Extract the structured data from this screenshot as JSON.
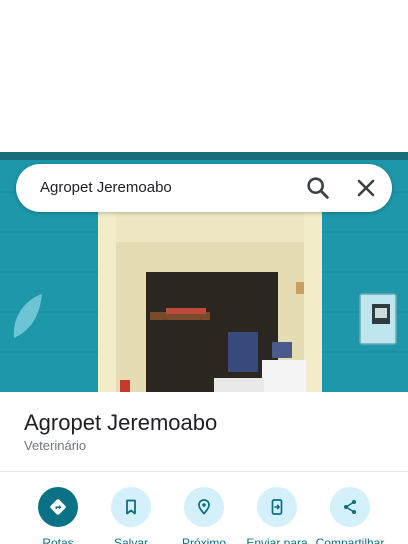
{
  "search": {
    "query": "Agropet Jeremoabo"
  },
  "place": {
    "title": "Agropet Jeremoabo",
    "category": "Veterinário"
  },
  "actions": [
    {
      "label": "Rotas",
      "icon": "directions-icon"
    },
    {
      "label": "Salvar",
      "icon": "bookmark-icon"
    },
    {
      "label": "Próximo",
      "icon": "nearby-icon"
    },
    {
      "label": "Enviar para",
      "icon": "send-to-phone-icon"
    },
    {
      "label": "Compartilhar",
      "icon": "share-icon"
    }
  ],
  "colors": {
    "primary_action": "#0b7186",
    "secondary_action": "#d4f0fa",
    "label_text": "#0b6f84",
    "storefront_wall": "#1d97ab"
  }
}
